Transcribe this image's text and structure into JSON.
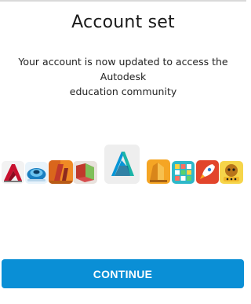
{
  "page": {
    "title": "Account set",
    "message_line1": "Your account is now updated to access the Autodesk",
    "message_line2": "education community"
  },
  "app_icons": [
    "autocad-icon",
    "maya-icon",
    "fusion-icon",
    "revit-icon",
    "autodesk-logo-icon",
    "inventor-icon",
    "sketchbook-icon",
    "rocket-icon",
    "tinkercad-icon"
  ],
  "colors": {
    "button": "#0a8fd6",
    "logo_blue": "#0696d7",
    "logo_teal": "#1cb4a8"
  },
  "actions": {
    "continue_label": "CONTINUE"
  }
}
